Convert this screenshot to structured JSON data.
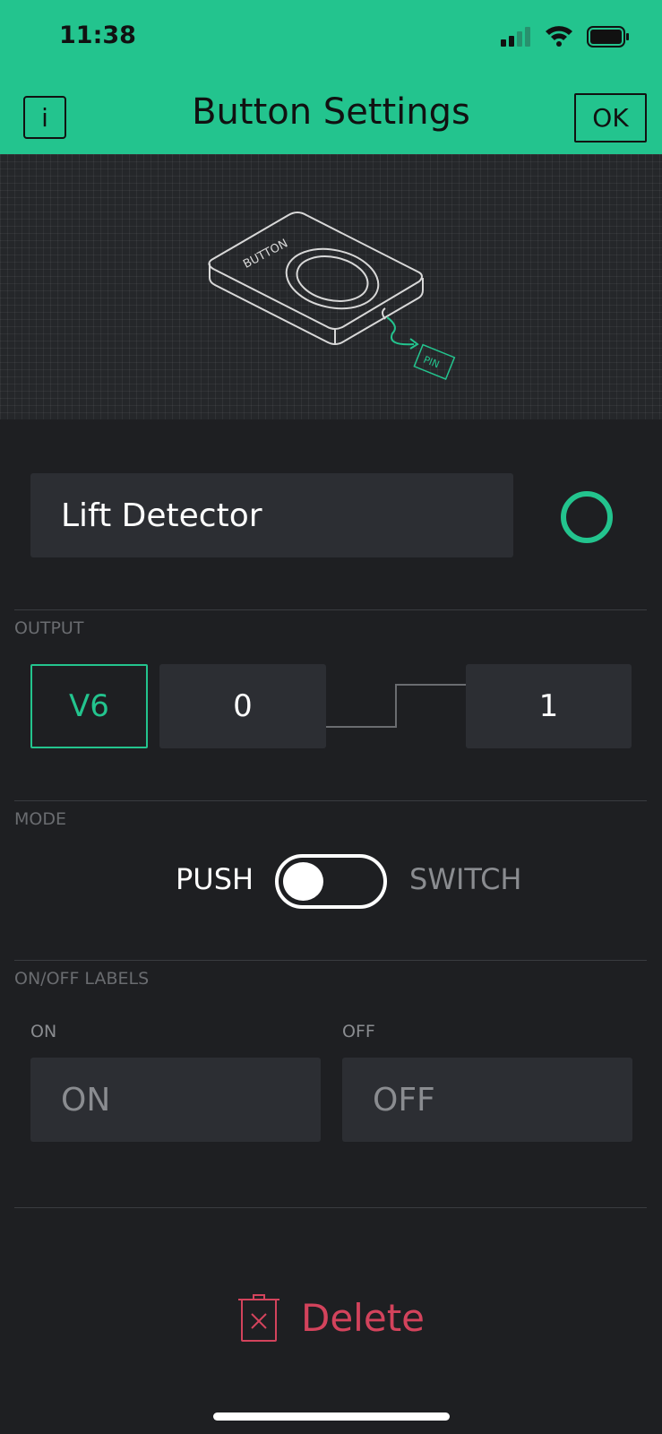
{
  "status_bar": {
    "time": "11:38"
  },
  "header": {
    "title": "Button Settings",
    "info_label": "i",
    "ok_label": "OK",
    "background_color": "#23c48e"
  },
  "illustration": {
    "device_label": "BUTTON",
    "pin_label": "PIN"
  },
  "name": {
    "value": "Lift Detector",
    "color": "#23c48e"
  },
  "output": {
    "section_label": "OUTPUT",
    "pin": "V6",
    "low_value": "0",
    "high_value": "1"
  },
  "mode": {
    "section_label": "MODE",
    "option_left": "PUSH",
    "option_right": "SWITCH",
    "selected": "PUSH"
  },
  "labels": {
    "section_label": "ON/OFF LABELS",
    "on_caption": "ON",
    "off_caption": "OFF",
    "on_placeholder": "ON",
    "off_placeholder": "OFF"
  },
  "delete": {
    "label": "Delete",
    "color": "#d3435c"
  }
}
